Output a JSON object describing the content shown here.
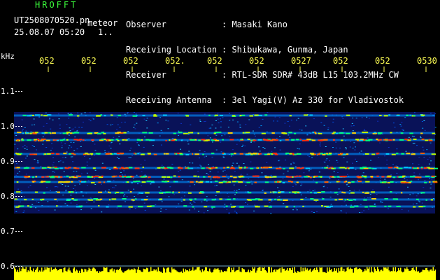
{
  "header": {
    "title": "HROFFT",
    "filename": "UT2508070520.pn",
    "tag": "meteor",
    "datetime": "25.08.07 05:20",
    "count": "1..",
    "info": [
      {
        "label": "Observer",
        "value": ": Masaki Kano"
      },
      {
        "label": "Receiving Location",
        "value": ": Shibukawa, Gunma, Japan"
      },
      {
        "label": "Receiver",
        "value": ": RTL-SDR SDR# 43dB L15 103.2MHz CW"
      },
      {
        "label": "Receiving Antenna",
        "value": ": 3el Yagi(V) Az 330 for Vladivostok"
      }
    ]
  },
  "colors": {
    "background": "#000000",
    "spectrogram_noise": "#1020a0",
    "signal_strong": "#ff3010",
    "baseline": "#ffff00",
    "text": "#ffffff",
    "title": "#3cff3c",
    "axis_labels": "#ffff55"
  },
  "chart_data": {
    "type": "heatmap",
    "ylabel": "kHz",
    "yticks": [
      "1.1",
      "1.0",
      "0.9",
      "0.8",
      "0.7",
      "0.6"
    ],
    "ylim": [
      0.6,
      1.1
    ],
    "xticks": [
      "052",
      "052",
      "052",
      "052.",
      "052",
      "052",
      "0527",
      "052",
      "052",
      "0530"
    ],
    "bands_khz": [
      1.03,
      0.98,
      0.96,
      0.92,
      0.88,
      0.855,
      0.84,
      0.81,
      0.79,
      0.77
    ],
    "band_intensity": [
      0.4,
      0.6,
      1.0,
      0.85,
      0.95,
      1.0,
      0.7,
      0.5,
      0.5,
      0.35
    ],
    "noise_range_khz": [
      0.75,
      1.04
    ],
    "baseline_level": 0.6
  }
}
